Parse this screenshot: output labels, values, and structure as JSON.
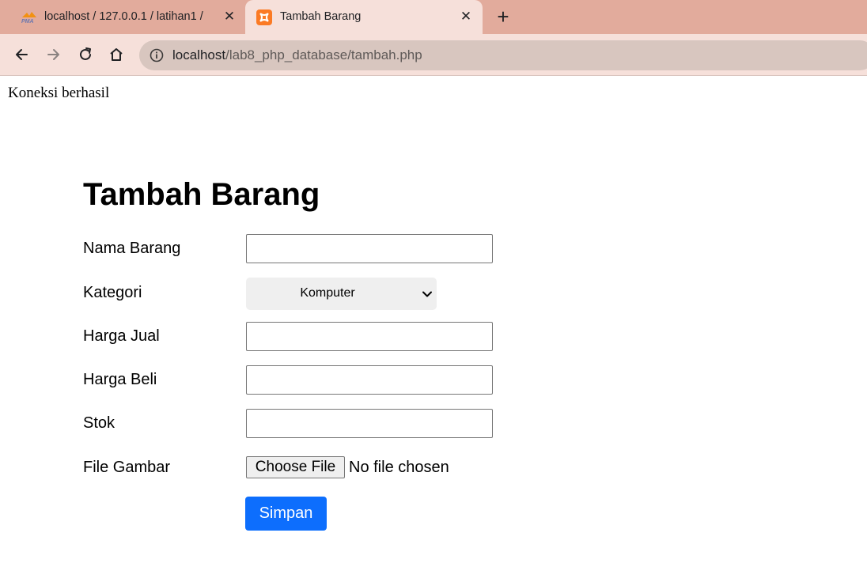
{
  "browser": {
    "tabs": [
      {
        "title": "localhost / 127.0.0.1 / latihan1 / ",
        "favicon": "phpmyadmin-icon",
        "active": false
      },
      {
        "title": "Tambah Barang",
        "favicon": "xampp-icon",
        "active": true
      }
    ],
    "address": {
      "host": "localhost",
      "path": "/lab8_php_database/tambah.php"
    }
  },
  "page": {
    "status_text": "Koneksi berhasil",
    "title": "Tambah Barang",
    "fields": {
      "nama_barang": {
        "label": "Nama Barang",
        "value": ""
      },
      "kategori": {
        "label": "Kategori",
        "selected": "Komputer"
      },
      "harga_jual": {
        "label": "Harga Jual",
        "value": ""
      },
      "harga_beli": {
        "label": "Harga Beli",
        "value": ""
      },
      "stok": {
        "label": "Stok",
        "value": ""
      },
      "file_gambar": {
        "label": "File Gambar",
        "button": "Choose File",
        "status": "No file chosen"
      }
    },
    "submit_label": "Simpan"
  },
  "colors": {
    "tabstrip": "#e2ab9c",
    "toolbar": "#f6e0da",
    "submit_button": "#0d6efd"
  }
}
